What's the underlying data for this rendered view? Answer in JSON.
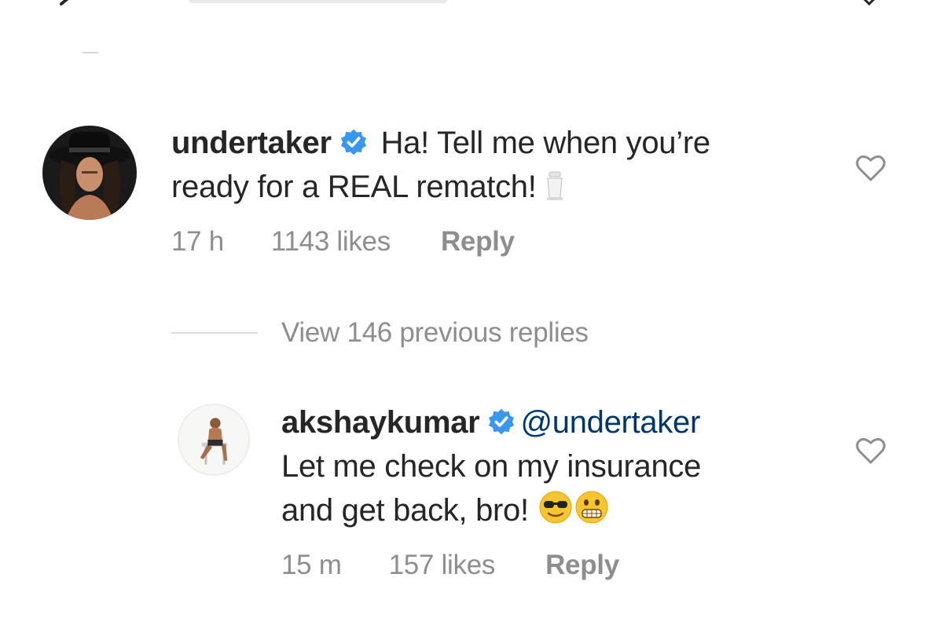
{
  "comments": [
    {
      "username": "undertaker",
      "verified": true,
      "text": "Ha! Tell me when you’re",
      "text_line2": "ready for a REAL rematch!",
      "emoji": "funeral-urn-emoji",
      "time": "17 h",
      "likes": "1143 likes",
      "reply_label": "Reply"
    }
  ],
  "replies_toggle": {
    "label": "View 146 previous replies"
  },
  "replies": [
    {
      "username": "akshaykumar",
      "verified": true,
      "mention": "@undertaker",
      "text_line1": "Let me check on my insurance",
      "text_line2": "and get back, bro!",
      "emojis": [
        "sunglasses-face-emoji",
        "grimacing-face-emoji"
      ],
      "time": "15 m",
      "likes": "157 likes",
      "reply_label": "Reply"
    }
  ],
  "colors": {
    "text": "#262626",
    "secondary": "#8e8e8e",
    "verified": "#3897f0",
    "mention": "#00376b"
  }
}
